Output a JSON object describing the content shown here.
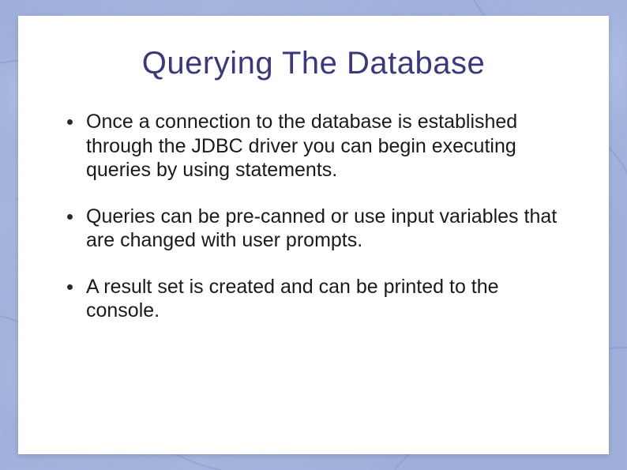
{
  "slide": {
    "title": "Querying The Database",
    "bullets": [
      "Once a connection to the database is established through the JDBC driver you can begin executing queries by using statements.",
      " Queries can be pre-canned or use input variables that are changed with user prompts.",
      "A result set is created and can be printed to the console."
    ]
  }
}
